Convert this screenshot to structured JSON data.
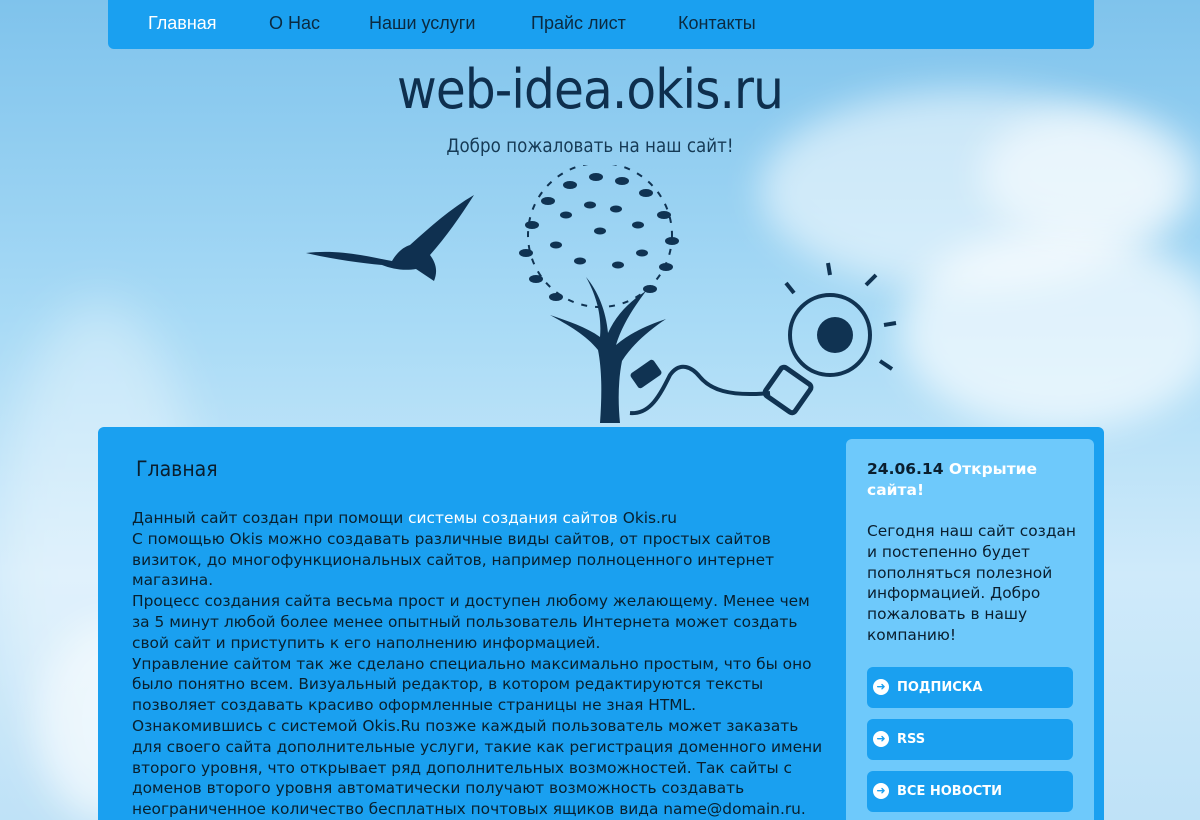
{
  "nav": {
    "items": [
      "Главная",
      "О Нас",
      "Наши услуги",
      "Прайс лист",
      "Контакты"
    ],
    "active_index": 0
  },
  "header": {
    "site_title": "web-idea.okis.ru",
    "subtitle": "Добро пожаловать на наш сайт!"
  },
  "main": {
    "heading": "Главная",
    "intro_prefix": "Данный сайт создан при помощи ",
    "intro_link": "системы создания сайтов",
    "intro_suffix": " Okis.ru",
    "p1": "С помощью Okis можно создавать различные виды сайтов, от простых сайтов визиток, до многофункциональных сайтов, например полноценного интернет магазина.",
    "p2": "Процесс создания сайта весьма прост и доступен любому желающему. Менее чем за 5 минут любой более менее опытный пользователь Интернета может создать свой сайт и приступить к его наполнению информацией.",
    "p3": "Управление сайтом так же сделано специально максимально простым, что бы оно было понятно всем. Визуальный редактор, в котором редактируются тексты позволяет создавать красиво оформленные страницы не зная HTML.",
    "p4": "Ознакомившись с системой Okis.Ru позже каждый пользователь может заказать для своего сайта дополнительные услуги, такие как регистрация доменного имени второго уровня, что открывает ряд дополнительных возможностей. Так сайты с доменов второго уровня автоматически получают возможность создавать неограниченное количество бесплатных почтовых ящиков вида name@domain.ru."
  },
  "sidebar": {
    "news_date": "24.06.14",
    "news_title": "Открытие сайта!",
    "news_text": "Сегодня наш сайт создан и постепенно будет пополняться полезной информацией. Добро пожаловать в нашу компанию!",
    "buttons": [
      "Подписка",
      "RSS",
      "Все новости"
    ]
  },
  "icons": {
    "button_arrow": "arrow-right-circle-icon",
    "illustration": [
      "bird-icon",
      "tree-icon",
      "lightbulb-icon"
    ]
  },
  "colors": {
    "nav_bg": "#1aa0f0",
    "main_bg": "#1aa0f0",
    "sidebar_bg": "#6ec9fb",
    "title_color": "#0e2f4e",
    "link_color": "#ffffff"
  }
}
